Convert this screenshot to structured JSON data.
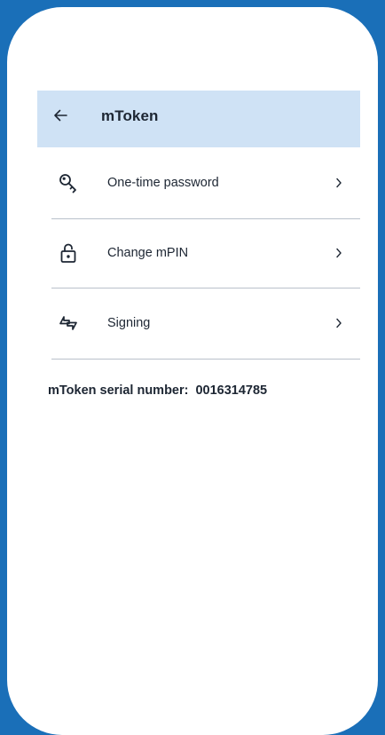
{
  "app_bar": {
    "title": "mToken",
    "back_icon": "arrow-left-icon"
  },
  "menu": [
    {
      "label": "One-time password",
      "icon": "key-icon"
    },
    {
      "label": "Change mPIN",
      "icon": "unlock-icon"
    },
    {
      "label": "Signing",
      "icon": "signing-arrows-icon"
    }
  ],
  "serial": {
    "label": "mToken serial number:",
    "value": "0016314785"
  },
  "colors": {
    "frame_background": "#1a6fb8",
    "app_bar_background": "#cfe2f5",
    "text": "#1d2633",
    "divider": "#b9c1cb"
  }
}
